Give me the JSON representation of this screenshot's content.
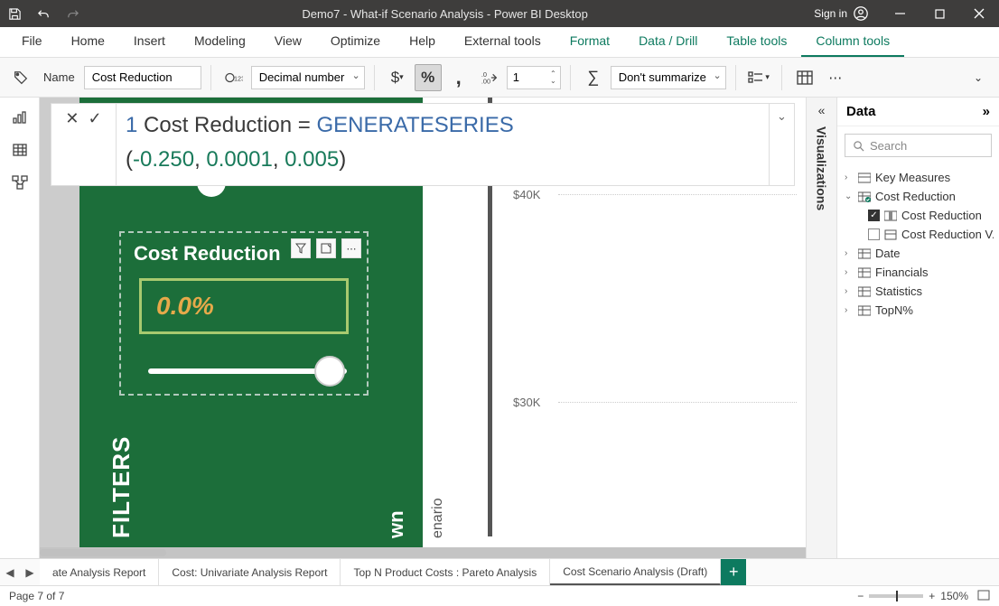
{
  "titlebar": {
    "title": "Demo7 - What-if Scenario Analysis - Power BI Desktop",
    "signin": "Sign in"
  },
  "ribbon": {
    "tabs": [
      "File",
      "Home",
      "Insert",
      "Modeling",
      "View",
      "Optimize",
      "Help",
      "External tools"
    ],
    "contextTabs": [
      "Format",
      "Data / Drill",
      "Table tools",
      "Column tools"
    ],
    "activeTab": "Column tools"
  },
  "toolbar": {
    "name_label": "Name",
    "name_value": "Cost Reduction",
    "datatype": "Decimal number",
    "decimals": "1",
    "summarize": "Don't summarize"
  },
  "formula": {
    "lineno": "1",
    "text_before_func": " Cost Reduction = ",
    "func": "GENERATESERIES",
    "args_open": "(",
    "num1": "-0.250",
    "sep1": ", ",
    "num2": "0.0001",
    "sep2": ", ",
    "num3": "0.005",
    "args_close": ")"
  },
  "card": {
    "title": "Cost Reduction",
    "value": "0.0%"
  },
  "chart": {
    "y1": "$40K",
    "y2": "$30K"
  },
  "canvasLabels": {
    "filters": "FILTERS",
    "wn": "wn",
    "enario": "enario"
  },
  "visualizations": {
    "label": "Visualizations"
  },
  "datapane": {
    "title": "Data",
    "search_placeholder": "Search",
    "items": [
      {
        "caret": ">",
        "icon": "measure",
        "label": "Key Measures"
      },
      {
        "caret": "v",
        "icon": "table-check",
        "label": "Cost Reduction"
      },
      {
        "checked": true,
        "icon": "column",
        "label": "Cost Reduction",
        "indent": 2
      },
      {
        "checked": false,
        "icon": "measure",
        "label": "Cost Reduction V...",
        "indent": 2
      },
      {
        "caret": ">",
        "icon": "table",
        "label": "Date"
      },
      {
        "caret": ">",
        "icon": "table",
        "label": "Financials"
      },
      {
        "caret": ">",
        "icon": "table",
        "label": "Statistics"
      },
      {
        "caret": ">",
        "icon": "table",
        "label": "TopN%"
      }
    ]
  },
  "pagetabs": {
    "tabs": [
      "ate Analysis Report",
      "Cost: Univariate Analysis Report",
      "Top N Product Costs : Pareto Analysis",
      "Cost Scenario Analysis (Draft)"
    ],
    "active": 3
  },
  "status": {
    "page": "Page 7 of 7",
    "zoom": "150%"
  }
}
